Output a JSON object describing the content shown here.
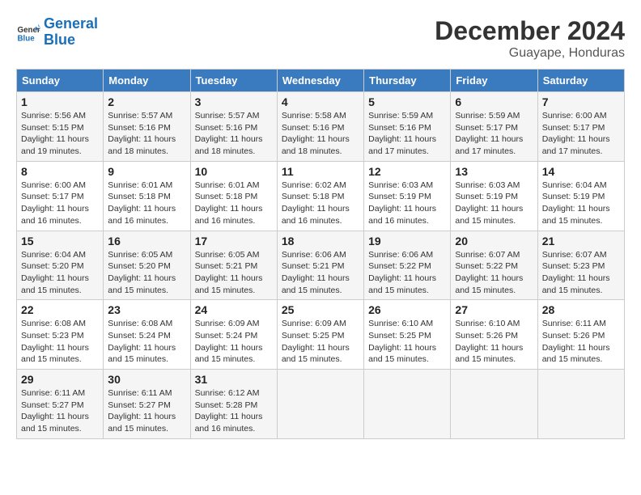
{
  "header": {
    "logo_line1": "General",
    "logo_line2": "Blue",
    "month_title": "December 2024",
    "subtitle": "Guayape, Honduras"
  },
  "days_of_week": [
    "Sunday",
    "Monday",
    "Tuesday",
    "Wednesday",
    "Thursday",
    "Friday",
    "Saturday"
  ],
  "weeks": [
    [
      {
        "day": "1",
        "info": "Sunrise: 5:56 AM\nSunset: 5:15 PM\nDaylight: 11 hours and 19 minutes."
      },
      {
        "day": "2",
        "info": "Sunrise: 5:57 AM\nSunset: 5:16 PM\nDaylight: 11 hours and 18 minutes."
      },
      {
        "day": "3",
        "info": "Sunrise: 5:57 AM\nSunset: 5:16 PM\nDaylight: 11 hours and 18 minutes."
      },
      {
        "day": "4",
        "info": "Sunrise: 5:58 AM\nSunset: 5:16 PM\nDaylight: 11 hours and 18 minutes."
      },
      {
        "day": "5",
        "info": "Sunrise: 5:59 AM\nSunset: 5:16 PM\nDaylight: 11 hours and 17 minutes."
      },
      {
        "day": "6",
        "info": "Sunrise: 5:59 AM\nSunset: 5:17 PM\nDaylight: 11 hours and 17 minutes."
      },
      {
        "day": "7",
        "info": "Sunrise: 6:00 AM\nSunset: 5:17 PM\nDaylight: 11 hours and 17 minutes."
      }
    ],
    [
      {
        "day": "8",
        "info": "Sunrise: 6:00 AM\nSunset: 5:17 PM\nDaylight: 11 hours and 16 minutes."
      },
      {
        "day": "9",
        "info": "Sunrise: 6:01 AM\nSunset: 5:18 PM\nDaylight: 11 hours and 16 minutes."
      },
      {
        "day": "10",
        "info": "Sunrise: 6:01 AM\nSunset: 5:18 PM\nDaylight: 11 hours and 16 minutes."
      },
      {
        "day": "11",
        "info": "Sunrise: 6:02 AM\nSunset: 5:18 PM\nDaylight: 11 hours and 16 minutes."
      },
      {
        "day": "12",
        "info": "Sunrise: 6:03 AM\nSunset: 5:19 PM\nDaylight: 11 hours and 16 minutes."
      },
      {
        "day": "13",
        "info": "Sunrise: 6:03 AM\nSunset: 5:19 PM\nDaylight: 11 hours and 15 minutes."
      },
      {
        "day": "14",
        "info": "Sunrise: 6:04 AM\nSunset: 5:19 PM\nDaylight: 11 hours and 15 minutes."
      }
    ],
    [
      {
        "day": "15",
        "info": "Sunrise: 6:04 AM\nSunset: 5:20 PM\nDaylight: 11 hours and 15 minutes."
      },
      {
        "day": "16",
        "info": "Sunrise: 6:05 AM\nSunset: 5:20 PM\nDaylight: 11 hours and 15 minutes."
      },
      {
        "day": "17",
        "info": "Sunrise: 6:05 AM\nSunset: 5:21 PM\nDaylight: 11 hours and 15 minutes."
      },
      {
        "day": "18",
        "info": "Sunrise: 6:06 AM\nSunset: 5:21 PM\nDaylight: 11 hours and 15 minutes."
      },
      {
        "day": "19",
        "info": "Sunrise: 6:06 AM\nSunset: 5:22 PM\nDaylight: 11 hours and 15 minutes."
      },
      {
        "day": "20",
        "info": "Sunrise: 6:07 AM\nSunset: 5:22 PM\nDaylight: 11 hours and 15 minutes."
      },
      {
        "day": "21",
        "info": "Sunrise: 6:07 AM\nSunset: 5:23 PM\nDaylight: 11 hours and 15 minutes."
      }
    ],
    [
      {
        "day": "22",
        "info": "Sunrise: 6:08 AM\nSunset: 5:23 PM\nDaylight: 11 hours and 15 minutes."
      },
      {
        "day": "23",
        "info": "Sunrise: 6:08 AM\nSunset: 5:24 PM\nDaylight: 11 hours and 15 minutes."
      },
      {
        "day": "24",
        "info": "Sunrise: 6:09 AM\nSunset: 5:24 PM\nDaylight: 11 hours and 15 minutes."
      },
      {
        "day": "25",
        "info": "Sunrise: 6:09 AM\nSunset: 5:25 PM\nDaylight: 11 hours and 15 minutes."
      },
      {
        "day": "26",
        "info": "Sunrise: 6:10 AM\nSunset: 5:25 PM\nDaylight: 11 hours and 15 minutes."
      },
      {
        "day": "27",
        "info": "Sunrise: 6:10 AM\nSunset: 5:26 PM\nDaylight: 11 hours and 15 minutes."
      },
      {
        "day": "28",
        "info": "Sunrise: 6:11 AM\nSunset: 5:26 PM\nDaylight: 11 hours and 15 minutes."
      }
    ],
    [
      {
        "day": "29",
        "info": "Sunrise: 6:11 AM\nSunset: 5:27 PM\nDaylight: 11 hours and 15 minutes."
      },
      {
        "day": "30",
        "info": "Sunrise: 6:11 AM\nSunset: 5:27 PM\nDaylight: 11 hours and 15 minutes."
      },
      {
        "day": "31",
        "info": "Sunrise: 6:12 AM\nSunset: 5:28 PM\nDaylight: 11 hours and 16 minutes."
      },
      null,
      null,
      null,
      null
    ]
  ]
}
